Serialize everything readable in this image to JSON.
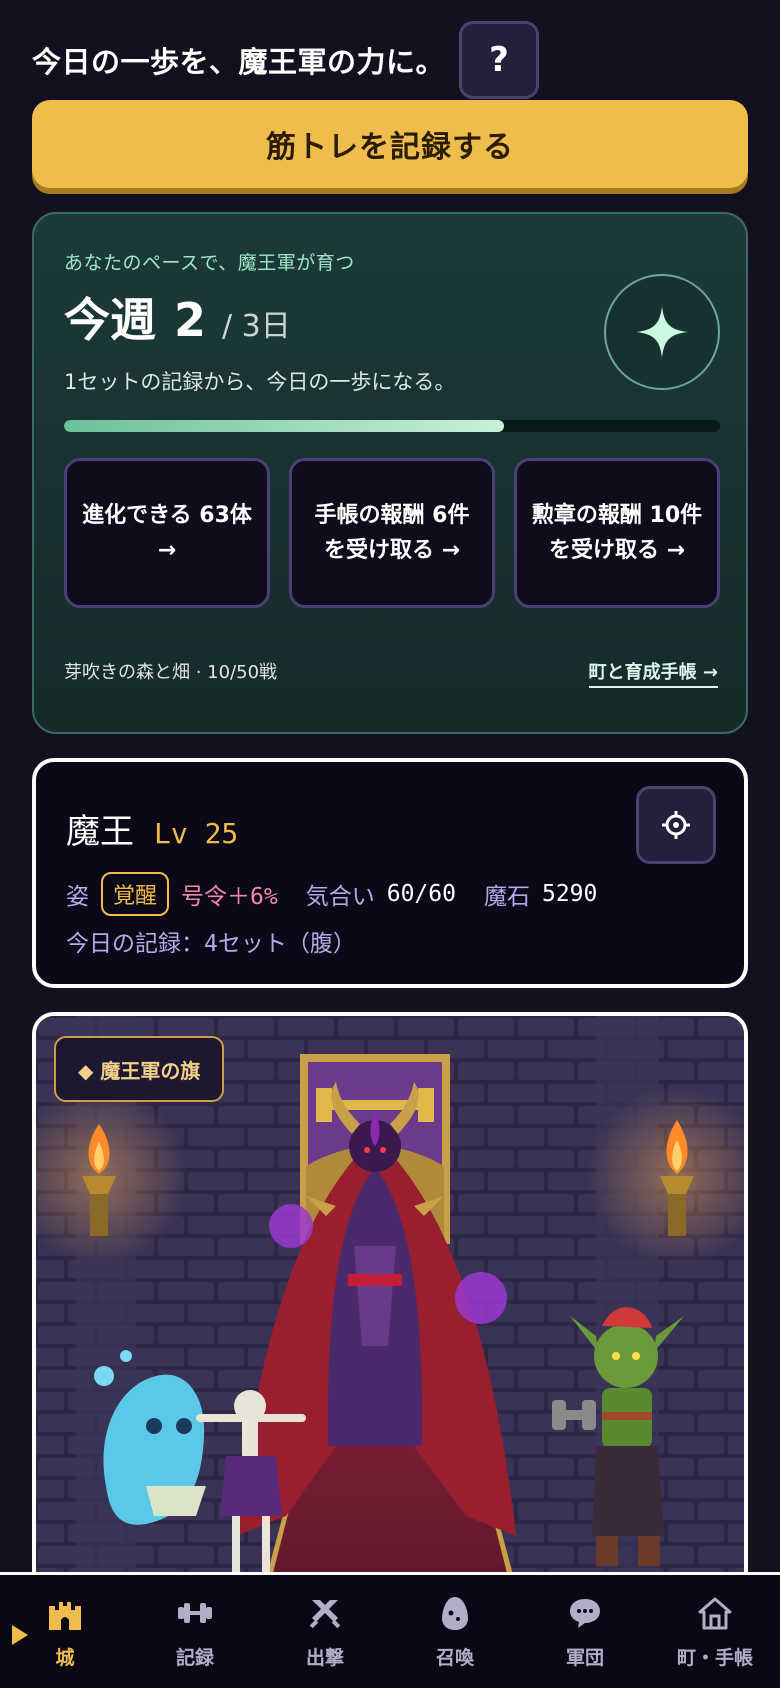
{
  "header": {
    "title": "今日の一歩を、魔王軍の力に。",
    "help_label": "?",
    "record_button": "筋トレを記録する"
  },
  "progress": {
    "subtitle": "あなたのペースで、魔王軍が育つ",
    "week_label": "今週",
    "week_count": "2",
    "week_goal": "/ 3日",
    "description": "1セットの記録から、今日の一歩になる。",
    "progress_fraction": 0.67,
    "tiles": [
      "進化できる 63体 →",
      "手帳の報酬 6件を受け取る →",
      "勲章の報酬 10件を受け取る →"
    ],
    "stage": "芽吹きの森と畑 · 10/50戦",
    "link": "町と育成手帳 →"
  },
  "status": {
    "name": "魔王",
    "level": "Lv 25",
    "form_label": "姿",
    "form_badge": "覚醒",
    "command_bonus": "号令＋6%",
    "spirit_label": "気合い",
    "spirit_value": "60/60",
    "stone_label": "魔石",
    "stone_value": "5290",
    "today_record": "今日の記録：4セット（腹）"
  },
  "scene": {
    "banner_label": "◆ 魔王軍の旗"
  },
  "nav": {
    "items": [
      {
        "label": "城",
        "icon": "castle-icon",
        "active": true
      },
      {
        "label": "記録",
        "icon": "dumbbell-icon",
        "active": false
      },
      {
        "label": "出撃",
        "icon": "crossed-swords-icon",
        "active": false
      },
      {
        "label": "召喚",
        "icon": "egg-icon",
        "active": false
      },
      {
        "label": "軍団",
        "icon": "chat-bubble-icon",
        "active": false
      },
      {
        "label": "町・手帳",
        "icon": "home-icon",
        "active": false
      }
    ]
  },
  "colors": {
    "accent_gold": "#f0bd4c",
    "teal_card": "#1c3a39",
    "background": "#13101f",
    "pink_stat": "#f08aa8",
    "lavender_label": "#b8a8e8"
  }
}
